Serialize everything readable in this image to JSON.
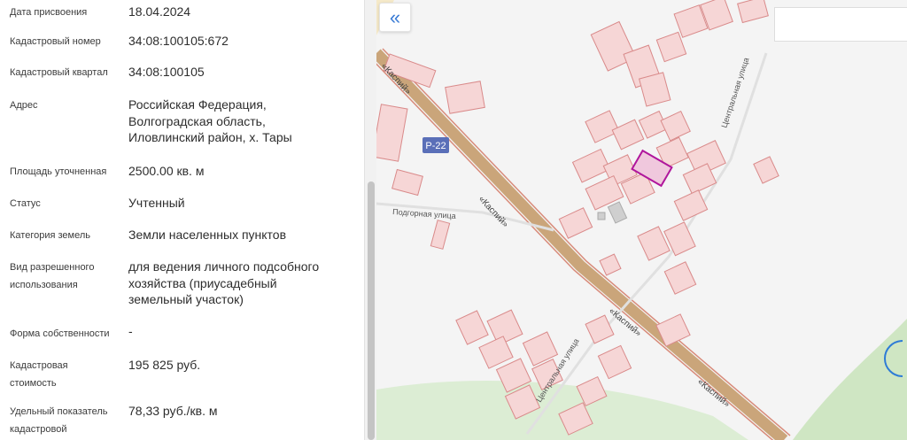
{
  "details": [
    {
      "label": "Дата присвоения",
      "value": "18.04.2024"
    },
    {
      "label": "Кадастровый номер",
      "value": "34:08:100105:672"
    },
    {
      "label": "Кадастровый квартал",
      "value": "34:08:100105"
    },
    {
      "label": "Адрес",
      "value": "Российская Федерация, Волгоградская область, Иловлинский район, х. Тары"
    },
    {
      "label": "Площадь уточненная",
      "value": "2500.00 кв. м"
    },
    {
      "label": "Статус",
      "value": "Учтенный"
    },
    {
      "label": "Категория земель",
      "value": "Земли населенных пунктов"
    },
    {
      "label": "Вид разрешенного использования",
      "value": "для ведения личного подсобного хозяйства (приусадебный земельный участок)"
    },
    {
      "label": "Форма собственности",
      "value": "-"
    },
    {
      "label": "Кадастровая стоимость",
      "value": "195 825 руб."
    },
    {
      "label": "Удельный показатель кадастровой",
      "value": "78,33 руб./кв. м"
    }
  ],
  "map": {
    "collapse_icon": "double-chevron-left-icon",
    "road_badge": "Р-22",
    "labels": {
      "kaspiy": "«Каспий»",
      "central_street": "Центральная улица",
      "podgornaya_street": "Подгорная улица"
    },
    "colors": {
      "parcel_fill": "#f6d6d6",
      "parcel_stroke": "#d98a8a",
      "selected_stroke": "#b0169c",
      "road": "#caa57a",
      "green": "#cfe6c3"
    }
  }
}
